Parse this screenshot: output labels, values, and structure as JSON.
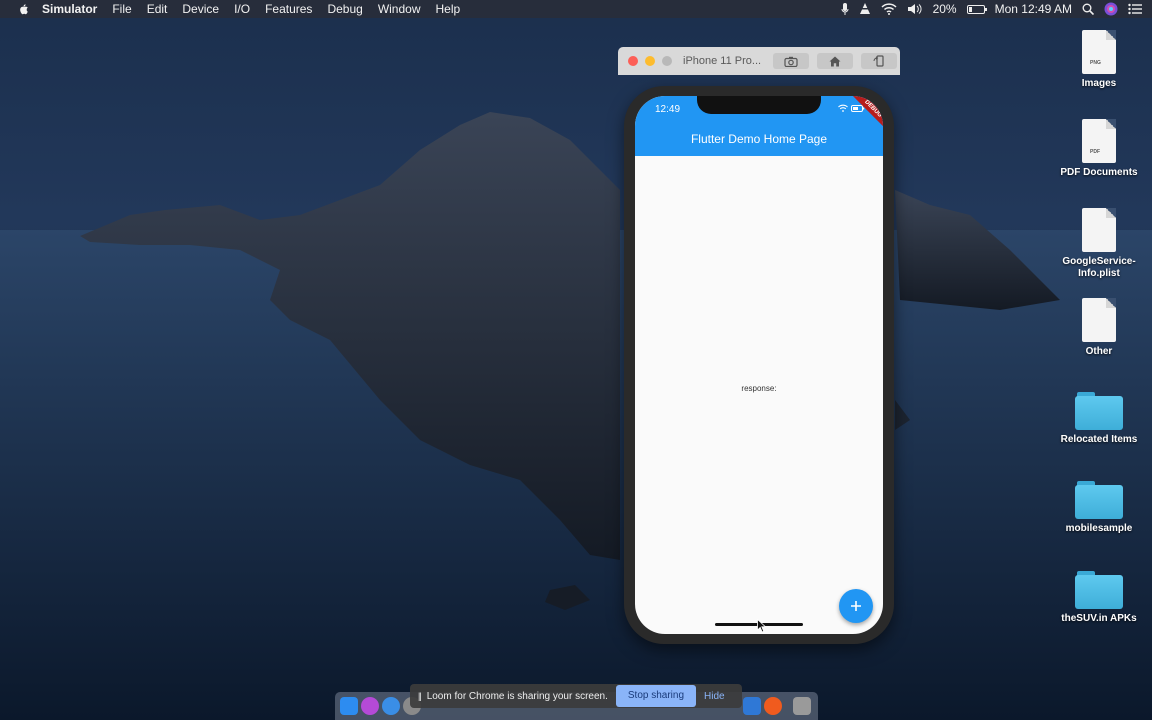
{
  "menubar": {
    "app_name": "Simulator",
    "items": [
      "File",
      "Edit",
      "Device",
      "I/O",
      "Features",
      "Debug",
      "Window",
      "Help"
    ],
    "battery": "20%",
    "clock": "Mon 12:49 AM"
  },
  "simulator": {
    "title": "iPhone 11 Pro...",
    "status_time": "12:49",
    "app_bar_title": "Flutter Demo Home Page",
    "debug_banner": "DEBUG",
    "response_text": "response:",
    "fab_icon": "plus-icon",
    "accent_color": "#2196f3"
  },
  "desktop_icons": [
    {
      "label": "Images",
      "type": "file",
      "tag": "PNG"
    },
    {
      "label": "PDF Documents",
      "type": "file",
      "tag": "PDF"
    },
    {
      "label": "GoogleService-Info.plist",
      "type": "file",
      "tag": ""
    },
    {
      "label": "Other",
      "type": "file",
      "tag": ""
    },
    {
      "label": "Relocated Items",
      "type": "folder"
    },
    {
      "label": "mobilesample",
      "type": "folder"
    },
    {
      "label": "theSUV.in APKs",
      "type": "folder"
    }
  ],
  "loom": {
    "message": "Loom for Chrome is sharing your screen.",
    "stop_label": "Stop sharing",
    "hide_label": "Hide",
    "pause_glyph": "||"
  }
}
